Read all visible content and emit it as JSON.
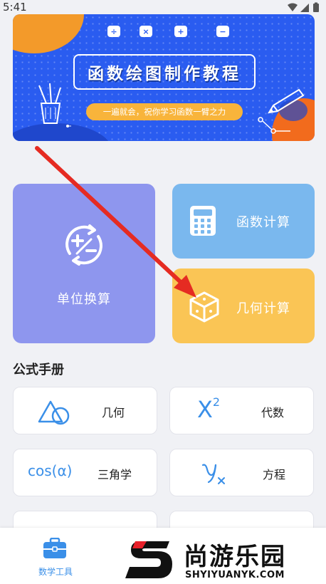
{
  "status_bar": {
    "time": "5:41",
    "icons": [
      "wifi-icon",
      "cellular-signal-icon",
      "battery-icon"
    ]
  },
  "banner": {
    "math_keys": [
      "÷",
      "×",
      "+",
      "−"
    ],
    "title": "函数绘图制作教程",
    "subtitle": "一遍就会，祝你学习函数一臂之力",
    "colors": {
      "background": "#2a5cf0",
      "accent": "#f39a2a",
      "pill": "#f8b43b"
    }
  },
  "tools": {
    "unit_conversion": {
      "label": "单位换算",
      "icon": "plus-minus-cycle-icon",
      "color": "#8e96ee"
    },
    "function_calc": {
      "label": "函数计算",
      "icon": "calculator-icon",
      "color": "#7ab8ee"
    },
    "geometry_calc": {
      "label": "几何计算",
      "icon": "cube-icon",
      "color": "#fac555"
    }
  },
  "formula_handbook": {
    "title": "公式手册",
    "items": [
      {
        "label": "几何",
        "icon": "triangle-circle-icon"
      },
      {
        "label": "代数",
        "icon_text": "X",
        "icon_sup": "2"
      },
      {
        "label": "三角学",
        "icon_text": "cos(α)"
      },
      {
        "label": "方程",
        "icon": "yx-icon"
      }
    ]
  },
  "bottom_nav": {
    "tabs": [
      {
        "label": "数学工具",
        "icon": "toolbox-icon",
        "active": true,
        "color": "#3a8fe8"
      }
    ]
  },
  "watermark": {
    "name": "尚游乐园",
    "url": "SHYIYUANYK.COM"
  }
}
